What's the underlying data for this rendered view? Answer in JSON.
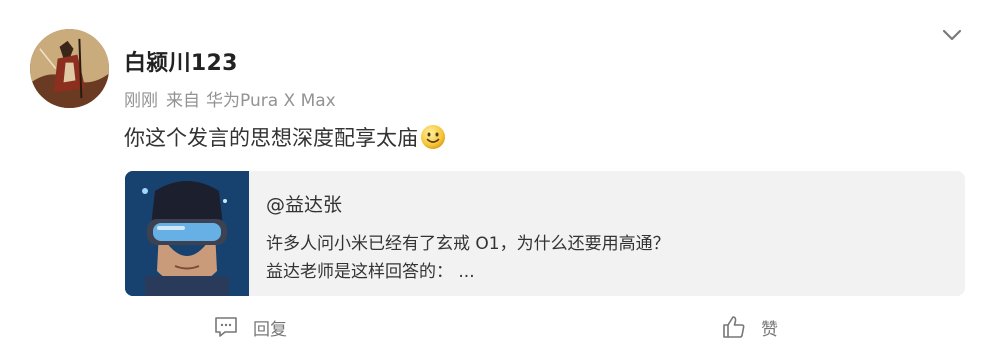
{
  "post": {
    "username": "白颍川123",
    "time": "刚刚",
    "source_prefix": "来自",
    "device": "华为Pura X Max",
    "content": "你这个发言的思想深度配享太庙",
    "emoji_icon": "smile-emoji-icon"
  },
  "shared": {
    "author": "@益达张",
    "line1": "许多人问小米已经有了玄戒 O1，为什么还要用高通？",
    "line2": "益达老师是这样回答的： ..."
  },
  "actions": {
    "reply_label": "回复",
    "like_label": "赞"
  },
  "colors": {
    "name": "#222222",
    "meta": "#939393",
    "card_bg": "#f2f2f2",
    "action": "#777777"
  }
}
